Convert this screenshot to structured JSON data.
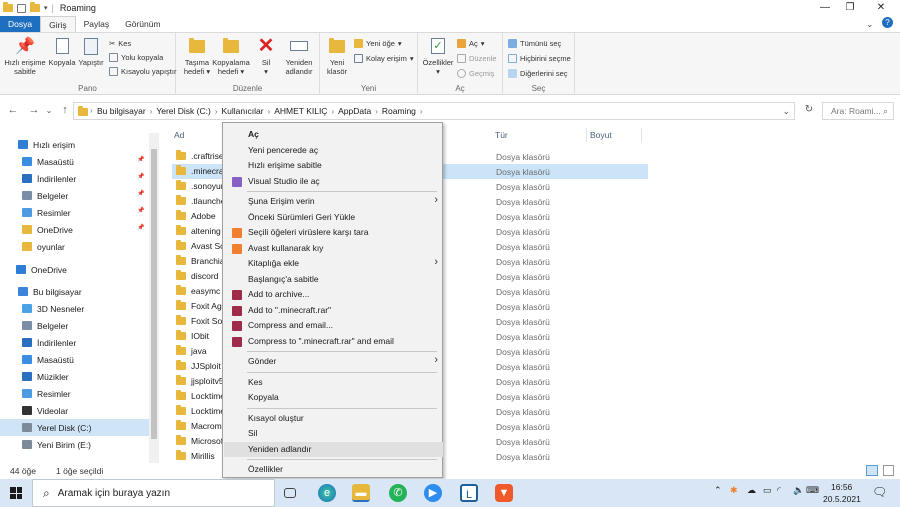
{
  "window": {
    "title": "Roaming"
  },
  "tabs": [
    {
      "label": "Dosya"
    },
    {
      "label": "Giriş"
    },
    {
      "label": "Paylaş"
    },
    {
      "label": "Görünüm"
    }
  ],
  "ribbon": {
    "pano": {
      "label": "Pano",
      "pin": "Hızlı erişime sabitle",
      "copy": "Kopyala",
      "paste": "Yapıştır",
      "cut": "Kes",
      "copy_path": "Yolu kopyala",
      "paste_shortcut": "Kısayolu yapıştır"
    },
    "duzenle": {
      "label": "Düzenle",
      "move": "Taşıma hedefi",
      "copyto": "Kopyalama hedefi",
      "delete": "Sil",
      "rename": "Yeniden adlandır"
    },
    "yeni": {
      "label": "Yeni",
      "new_folder": "Yeni klasör",
      "new_item": "Yeni öğe",
      "easy_access": "Kolay erişim"
    },
    "ac": {
      "label": "Aç",
      "properties": "Özellikler",
      "open": "Aç",
      "edit": "Düzenle",
      "history": "Geçmiş"
    },
    "sec": {
      "label": "Seç",
      "select_all": "Tümünü seç",
      "select_none": "Hiçbirini seçme",
      "invert": "Diğerlerini seç"
    }
  },
  "address": {
    "crumbs": [
      "Bu bilgisayar",
      "Yerel Disk (C:)",
      "Kullanıcılar",
      "AHMET KILIÇ",
      "AppData",
      "Roaming"
    ],
    "search_placeholder": "Ara: Roami..."
  },
  "nav": [
    {
      "label": "Hızlı erişim",
      "color": "#2f7fd6"
    },
    {
      "label": "Masaüstü",
      "color": "#3a8de0",
      "pinned": true
    },
    {
      "label": "İndirilenler",
      "color": "#2a6fc0",
      "pinned": true
    },
    {
      "label": "Belgeler",
      "color": "#7b8ea8",
      "pinned": true
    },
    {
      "label": "Resimler",
      "color": "#4d9be0",
      "pinned": true
    },
    {
      "label": "OneDrive",
      "color": "#e8b83d",
      "pinned": true
    },
    {
      "label": "oyunlar",
      "color": "#e8b83d"
    },
    {
      "label": "OneDrive",
      "color": "#2d7fd6"
    },
    {
      "label": "Bu bilgisayar",
      "color": "#3b84d8"
    },
    {
      "label": "3D Nesneler",
      "color": "#4aa3e5"
    },
    {
      "label": "Belgeler",
      "color": "#7b8ea8"
    },
    {
      "label": "İndirilenler",
      "color": "#2a6fc0"
    },
    {
      "label": "Masaüstü",
      "color": "#3a8de0"
    },
    {
      "label": "Müzikler",
      "color": "#2a6fc0"
    },
    {
      "label": "Resimler",
      "color": "#4d9be0"
    },
    {
      "label": "Videolar",
      "color": "#333"
    },
    {
      "label": "Yerel Disk (C:)",
      "color": "#7d8a99"
    },
    {
      "label": "Yeni Birim (E:)",
      "color": "#7d8a99"
    }
  ],
  "columns": {
    "name": "Ad",
    "type": "Tür",
    "size": "Boyut"
  },
  "files": [
    {
      "name": ".craftrise",
      "type": "Dosya klasörü"
    },
    {
      "name": ".minecraf",
      "type": "Dosya klasörü"
    },
    {
      "name": ".sonoyun",
      "type": "Dosya klasörü"
    },
    {
      "name": ".tlaunche",
      "type": "Dosya klasörü"
    },
    {
      "name": "Adobe",
      "type": "Dosya klasörü"
    },
    {
      "name": "altening",
      "type": "Dosya klasörü"
    },
    {
      "name": "Avast So",
      "type": "Dosya klasörü"
    },
    {
      "name": "Branchiat",
      "type": "Dosya klasörü"
    },
    {
      "name": "discord",
      "type": "Dosya klasörü"
    },
    {
      "name": "easymc",
      "type": "Dosya klasörü"
    },
    {
      "name": "Foxit Age",
      "type": "Dosya klasörü"
    },
    {
      "name": "Foxit Sof",
      "type": "Dosya klasörü"
    },
    {
      "name": "IObit",
      "type": "Dosya klasörü"
    },
    {
      "name": "java",
      "type": "Dosya klasörü"
    },
    {
      "name": "JJSploit v",
      "type": "Dosya klasörü"
    },
    {
      "name": "jjsploitv5",
      "type": "Dosya klasörü"
    },
    {
      "name": "Locktime",
      "type": "Dosya klasörü"
    },
    {
      "name": "Locktime",
      "type": "Dosya klasörü"
    },
    {
      "name": "Macrome",
      "type": "Dosya klasörü"
    },
    {
      "name": "Microsof",
      "type": "Dosya klasörü"
    },
    {
      "name": "Mirillis",
      "type": "Dosya klasörü"
    }
  ],
  "context_menu": {
    "items": [
      {
        "label": "Aç",
        "bold": true
      },
      {
        "label": "Yeni pencerede aç"
      },
      {
        "label": "Hızlı erişime sabitle"
      },
      {
        "label": "Visual Studio ile aç",
        "icon": "#8661c5"
      },
      {
        "sep": true
      },
      {
        "label": "Şuna Erişim verin",
        "sub": true
      },
      {
        "label": "Önceki Sürümleri Geri Yükle"
      },
      {
        "label": "Seçili öğeleri virüslere karşı tara",
        "icon": "#f08030"
      },
      {
        "label": "Avast kullanarak kıy",
        "icon": "#f08030"
      },
      {
        "label": "Kitaplığa ekle",
        "sub": true
      },
      {
        "label": "Başlangıç'a sabitle"
      },
      {
        "label": "Add to archive...",
        "icon": "#a02a4a"
      },
      {
        "label": "Add to \".minecraft.rar\"",
        "icon": "#a02a4a"
      },
      {
        "label": "Compress and email...",
        "icon": "#a02a4a"
      },
      {
        "label": "Compress to \".minecraft.rar\" and email",
        "icon": "#a02a4a"
      },
      {
        "sep": true
      },
      {
        "label": "Gönder",
        "sub": true
      },
      {
        "sep": true
      },
      {
        "label": "Kes"
      },
      {
        "label": "Kopyala"
      },
      {
        "sep": true
      },
      {
        "label": "Kısayol oluştur"
      },
      {
        "label": "Sil"
      },
      {
        "label": "Yeniden adlandır",
        "highlight": true
      },
      {
        "sep": true
      },
      {
        "label": "Özellikler"
      }
    ]
  },
  "status": {
    "count": "44 öğe",
    "selected": "1 öğe seçildi"
  },
  "taskbar": {
    "search_placeholder": "Aramak için buraya yazın",
    "time": "16:56",
    "date": "20.5.2021"
  }
}
